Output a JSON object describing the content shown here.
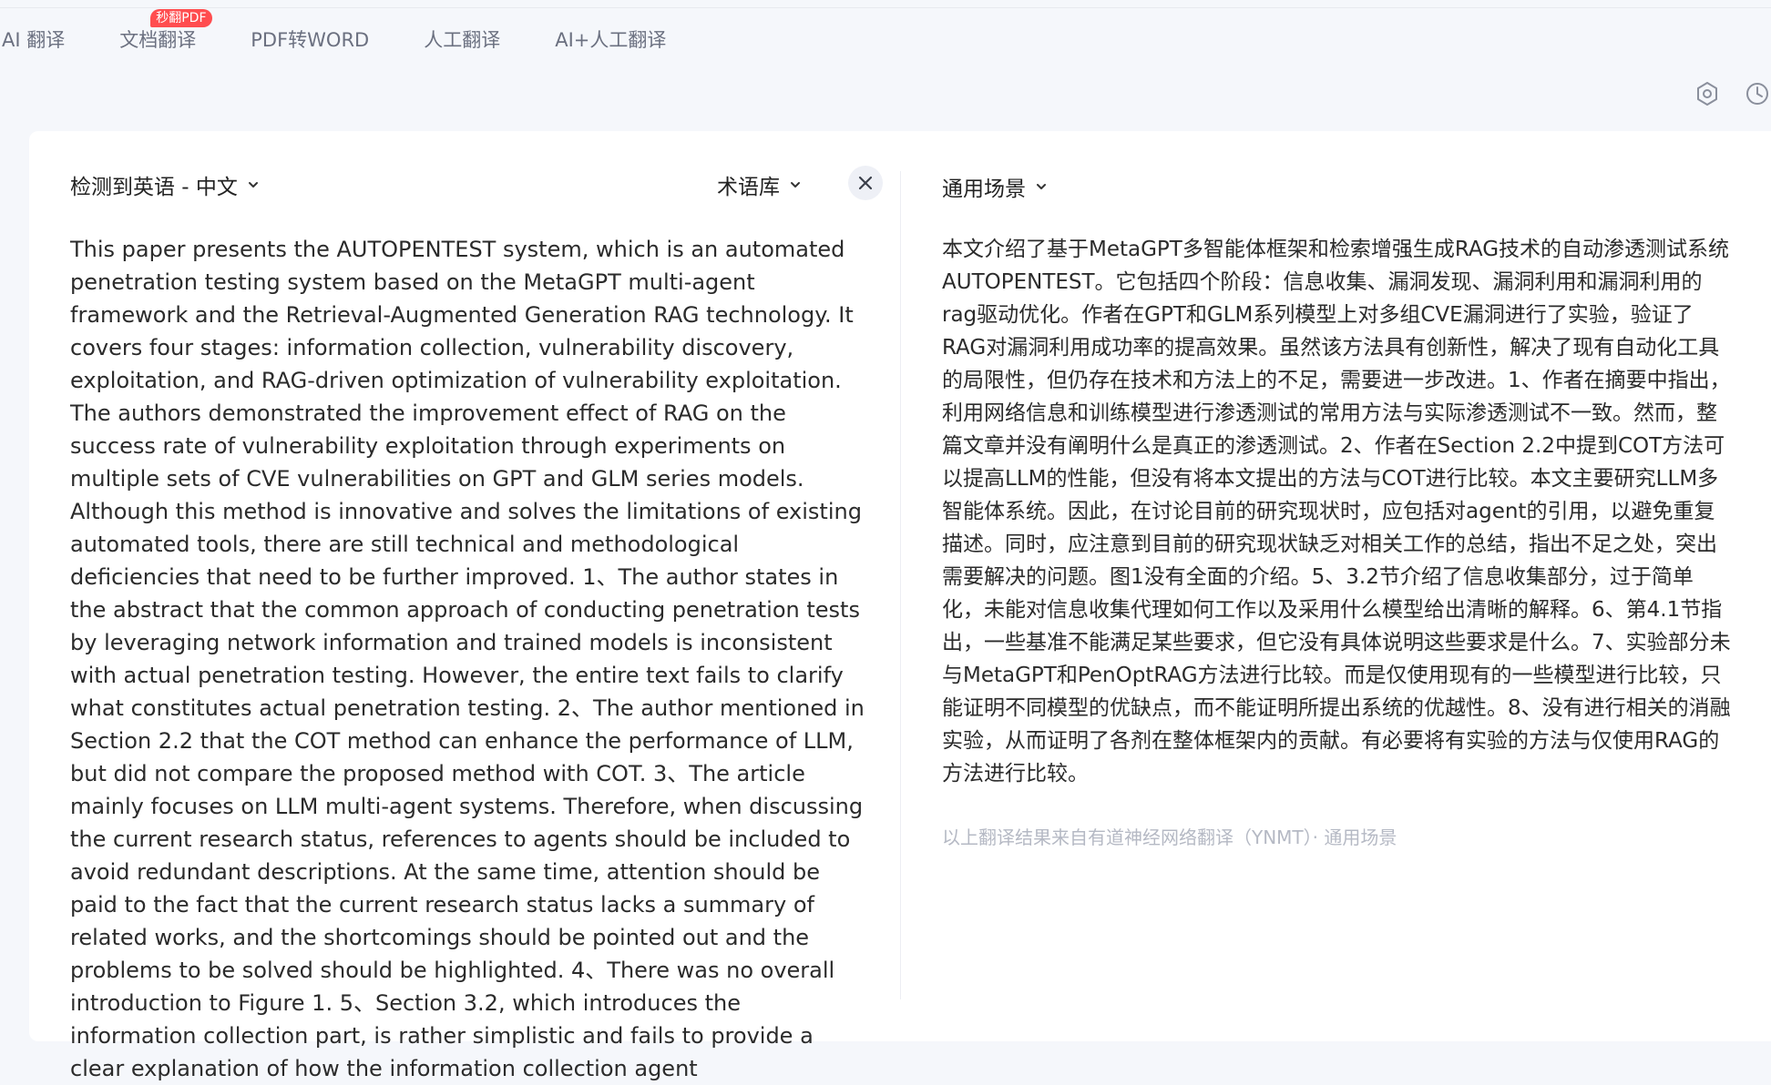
{
  "nav": {
    "tabs": [
      {
        "label": "AI 翻译"
      },
      {
        "label": "文档翻译",
        "badge": "秒翻PDF"
      },
      {
        "label": "PDF转WORD"
      },
      {
        "label": "人工翻译"
      },
      {
        "label": "AI+人工翻译"
      }
    ]
  },
  "toolbar_icons": [
    "settings-icon",
    "history-icon"
  ],
  "source_panel": {
    "language_selector": "检测到英语 - 中文",
    "glossary_selector": "术语库",
    "clear_icon": "close-icon",
    "text": "This paper presents the AUTOPENTEST system, which is an automated penetration testing system based on the MetaGPT multi-agent framework and the Retrieval-Augmented Generation RAG technology. It covers four stages: information collection, vulnerability discovery, exploitation, and RAG-driven optimization of vulnerability exploitation. The authors demonstrated the improvement effect of RAG on the success rate of vulnerability exploitation through experiments on multiple sets of CVE vulnerabilities on GPT and GLM series models. Although this method is innovative and solves the limitations of existing automated tools, there are still technical and methodological deficiencies that need to be further improved. 1、The author states in the abstract that the common approach of conducting penetration tests by leveraging network information and trained models is inconsistent with actual penetration testing. However, the entire text fails to clarify what constitutes actual penetration testing. 2、The author mentioned in Section 2.2 that the COT method can enhance the performance of LLM, but did not compare the proposed method with COT. 3、The article mainly focuses on LLM multi-agent systems. Therefore, when discussing the current research status, references to agents should be included to avoid redundant descriptions. At the same time, attention should be paid to the fact that the current research status lacks a summary of related works, and the shortcomings should be pointed out and the problems to be solved should be highlighted. 4、There was no overall introduction to Figure 1. 5、Section 3.2, which introduces the information collection part, is rather simplistic and fails to provide a clear explanation of how the information collection agent"
  },
  "target_panel": {
    "scene_selector": "通用场景",
    "text": "本文介绍了基于MetaGPT多智能体框架和检索增强生成RAG技术的自动渗透测试系统AUTOPENTEST。它包括四个阶段：信息收集、漏洞发现、漏洞利用和漏洞利用的rag驱动优化。作者在GPT和GLM系列模型上对多组CVE漏洞进行了实验，验证了RAG对漏洞利用成功率的提高效果。虽然该方法具有创新性，解决了现有自动化工具的局限性，但仍存在技术和方法上的不足，需要进一步改进。1、作者在摘要中指出，利用网络信息和训练模型进行渗透测试的常用方法与实际渗透测试不一致。然而，整篇文章并没有阐明什么是真正的渗透测试。2、作者在Section 2.2中提到COT方法可以提高LLM的性能，但没有将本文提出的方法与COT进行比较。本文主要研究LLM多智能体系统。因此，在讨论目前的研究现状时，应包括对agent的引用，以避免重复描述。同时，应注意到目前的研究现状缺乏对相关工作的总结，指出不足之处，突出需要解决的问题。图1没有全面的介绍。5、3.2节介绍了信息收集部分，过于简单化，未能对信息收集代理如何工作以及采用什么模型给出清晰的解释。6、第4.1节指出，一些基准不能满足某些要求，但它没有具体说明这些要求是什么。7、实验部分未与MetaGPT和PenOptRAG方法进行比较。而是仅使用现有的一些模型进行比较，只能证明不同模型的优缺点，而不能证明所提出系统的优越性。8、没有进行相关的消融实验，从而证明了各剂在整体框架内的贡献。有必要将有实验的方法与仅使用RAG的方法进行比较。",
    "source_note": "以上翻译结果来自有道神经网络翻译（YNMT）· 通用场景"
  }
}
